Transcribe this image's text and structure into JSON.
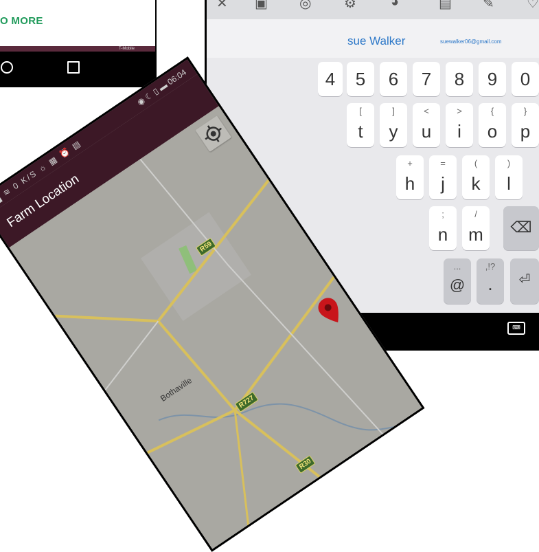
{
  "left_phone": {
    "read_more": "O MORE",
    "mini_status": "T-Mobile"
  },
  "keyboard": {
    "toolbar_icons": [
      "close-icon",
      "gif-icon",
      "sticker-icon",
      "settings-icon",
      "palette-icon",
      "clipboard-icon",
      "pin-icon",
      "heart-icon"
    ],
    "suggestion_name": "sue Walker",
    "suggestion_email": "suewalker06@gmail.com",
    "rows": {
      "numbers": [
        "4",
        "5",
        "6",
        "7",
        "8",
        "9",
        "0"
      ],
      "row2": [
        {
          "main": "t",
          "alt": "["
        },
        {
          "main": "y",
          "alt": "]"
        },
        {
          "main": "u",
          "alt": "<"
        },
        {
          "main": "i",
          "alt": ">"
        },
        {
          "main": "o",
          "alt": "{"
        },
        {
          "main": "p",
          "alt": "}"
        }
      ],
      "row3": [
        {
          "main": "h",
          "alt": "+"
        },
        {
          "main": "j",
          "alt": "="
        },
        {
          "main": "k",
          "alt": "("
        },
        {
          "main": "l",
          "alt": ")"
        }
      ],
      "row4": [
        {
          "main": "n",
          "alt": ";"
        },
        {
          "main": "m",
          "alt": "/"
        }
      ],
      "row5": [
        {
          "main": "@",
          "alt": "..."
        },
        {
          "main": ".",
          "alt": ",!?"
        }
      ]
    }
  },
  "phone": {
    "status_time": "06:04",
    "status_left": "0 K/S",
    "app_title": "Farm Location",
    "map": {
      "town": "Bothaville",
      "shields": [
        "R59",
        "R727",
        "R30"
      ],
      "marker_color": "#c8151b"
    }
  },
  "colors": {
    "app_bar": "#3c1826",
    "keyboard_bg": "#e9e9ec",
    "suggestion_text": "#2d78c8",
    "read_more": "#1f9a5a"
  }
}
